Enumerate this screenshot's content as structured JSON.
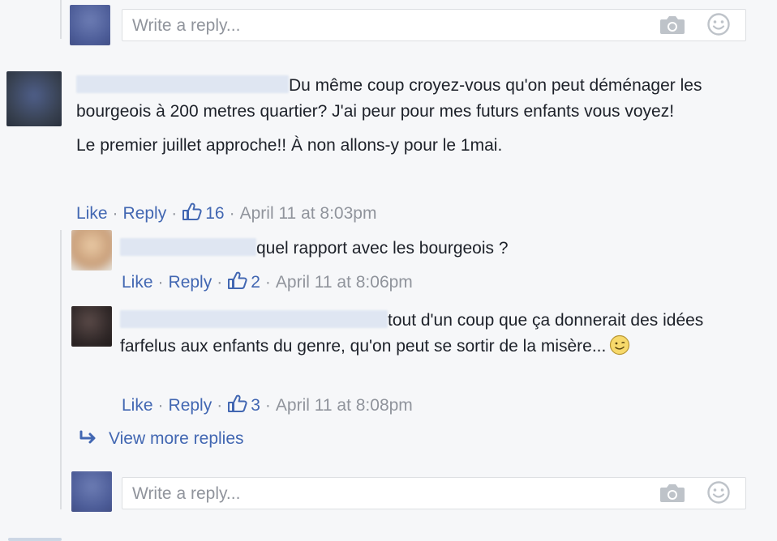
{
  "top_reply_box": {
    "placeholder": "Write a reply..."
  },
  "comment_main": {
    "text_line1": "Du même coup croyez-vous qu'on peut déménager les bourgeois à 200 metres quartier? J'ai peur pour mes futurs enfants vous voyez!",
    "text_line2": "Le premier juillet approche!! À non allons-y pour le 1mai.",
    "like_label": "Like",
    "reply_label": "Reply",
    "like_count": "16",
    "timestamp": "April 11 at 8:03pm"
  },
  "reply_1": {
    "text": "quel rapport avec les bourgeois ?",
    "like_label": "Like",
    "reply_label": "Reply",
    "like_count": "2",
    "timestamp": "April 11 at 8:06pm"
  },
  "reply_2": {
    "text": "tout d'un coup que ça donnerait des idées farfelus aux enfants du genre, qu'on peut se sortir de la misère...",
    "like_label": "Like",
    "reply_label": "Reply",
    "like_count": "3",
    "timestamp": "April 11 at 8:08pm"
  },
  "view_more_replies": "View more replies",
  "bottom_reply_box": {
    "placeholder": "Write a reply..."
  },
  "separator": "·",
  "icons": {
    "camera": "camera-icon",
    "smiley": "smiley-icon",
    "thumbs_up": "thumbs-up-icon",
    "reply_arrow": "reply-arrow-icon",
    "emoji": "smiling-emoji-icon"
  },
  "colors": {
    "link": "#4267b2",
    "meta": "#90949c",
    "text": "#1d2129",
    "background": "#f6f7f9"
  }
}
